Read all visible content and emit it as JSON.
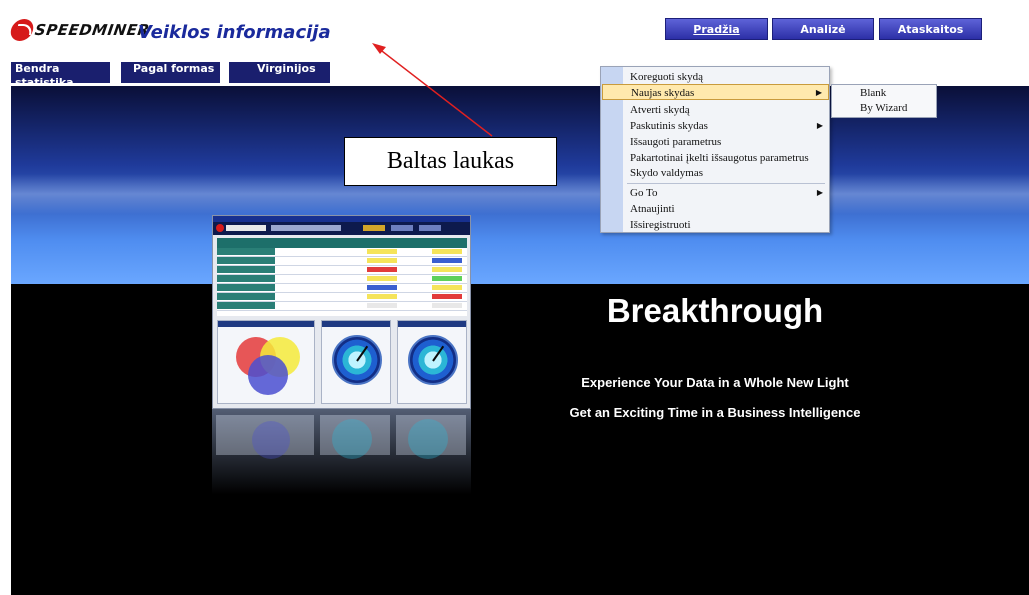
{
  "header": {
    "logo_text": "SPEEDMINER",
    "title": "Veiklos informacija",
    "nav": [
      "Pradžia",
      "Analizė",
      "Ataskaitos"
    ]
  },
  "subnav": [
    "Bendra statistika",
    "Pagal formas",
    "Virginijos"
  ],
  "banner": {
    "headline": "Breakthrough",
    "line1": "Experience Your Data in a Whole New Light",
    "line2": "Get an Exciting Time in a Business Intelligence"
  },
  "annotation": {
    "label": "Baltas laukas"
  },
  "context_menu": {
    "items": [
      {
        "label": "Koreguoti skydą"
      },
      {
        "label": "Naujas skydas"
      },
      {
        "label": "Atverti skydą"
      },
      {
        "label": "Paskutinis skydas"
      },
      {
        "label": "Išsaugoti parametrus"
      },
      {
        "label": "Pakartotinai įkelti išsaugotus parametrus"
      },
      {
        "label": "Skydo valdymas"
      },
      {
        "label": "Go To"
      },
      {
        "label": "Atnaujinti"
      },
      {
        "label": "Išsiregistruoti"
      }
    ],
    "submenu": [
      "Blank",
      "By Wizard"
    ]
  },
  "colors": {
    "nav_button": "#3b3fc0",
    "subnav_button": "#1a1f6e",
    "title_blue": "#1a2a9c",
    "menu_highlight": "#ffe9ad",
    "arrow_red": "#e02020"
  }
}
